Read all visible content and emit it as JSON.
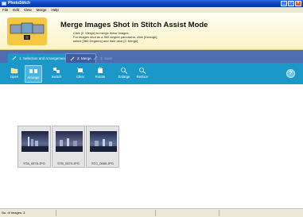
{
  "window": {
    "title": "PhotoStitch"
  },
  "menu": [
    "File",
    "Edit",
    "View",
    "Merge",
    "Help"
  ],
  "banner": {
    "heading": "Merge Images Shot in Stitch Assist Mode",
    "lines": [
      "Click [2. Merge] to merge these images.",
      "For images shot as a 360 degree panorama, click [Arrange],",
      "select [360 Degrees] and then click [2. Merge]."
    ]
  },
  "tabs": [
    {
      "label": "1. Selection and Arrangement",
      "state": "active"
    },
    {
      "label": "2. Merge",
      "state": "normal"
    },
    {
      "label": "3. Save",
      "state": "disabled"
    }
  ],
  "toolbar": {
    "tools": [
      {
        "label": "Open",
        "icon": "open-icon"
      },
      {
        "label": "Arrange",
        "icon": "arrange-icon",
        "selected": true
      },
      {
        "label": "Switch",
        "icon": "switch-icon"
      },
      {
        "label": "Clear",
        "icon": "clear-icon"
      },
      {
        "label": "Rotate",
        "icon": "rotate-icon"
      },
      {
        "label": "Enlarge",
        "icon": "enlarge-icon"
      },
      {
        "label": "Reduce",
        "icon": "reduce-icon"
      }
    ],
    "help_label": "?"
  },
  "images": [
    {
      "filename": "STA_0578.JPG"
    },
    {
      "filename": "STB_0579.JPG"
    },
    {
      "filename": "STC_0580.JPG"
    }
  ],
  "status": {
    "text": "No. of Images: 3"
  },
  "colors": {
    "toolbar": "#1b97c8",
    "tabbar": "#4f6db0",
    "titlebar": "#0a3fb8"
  }
}
